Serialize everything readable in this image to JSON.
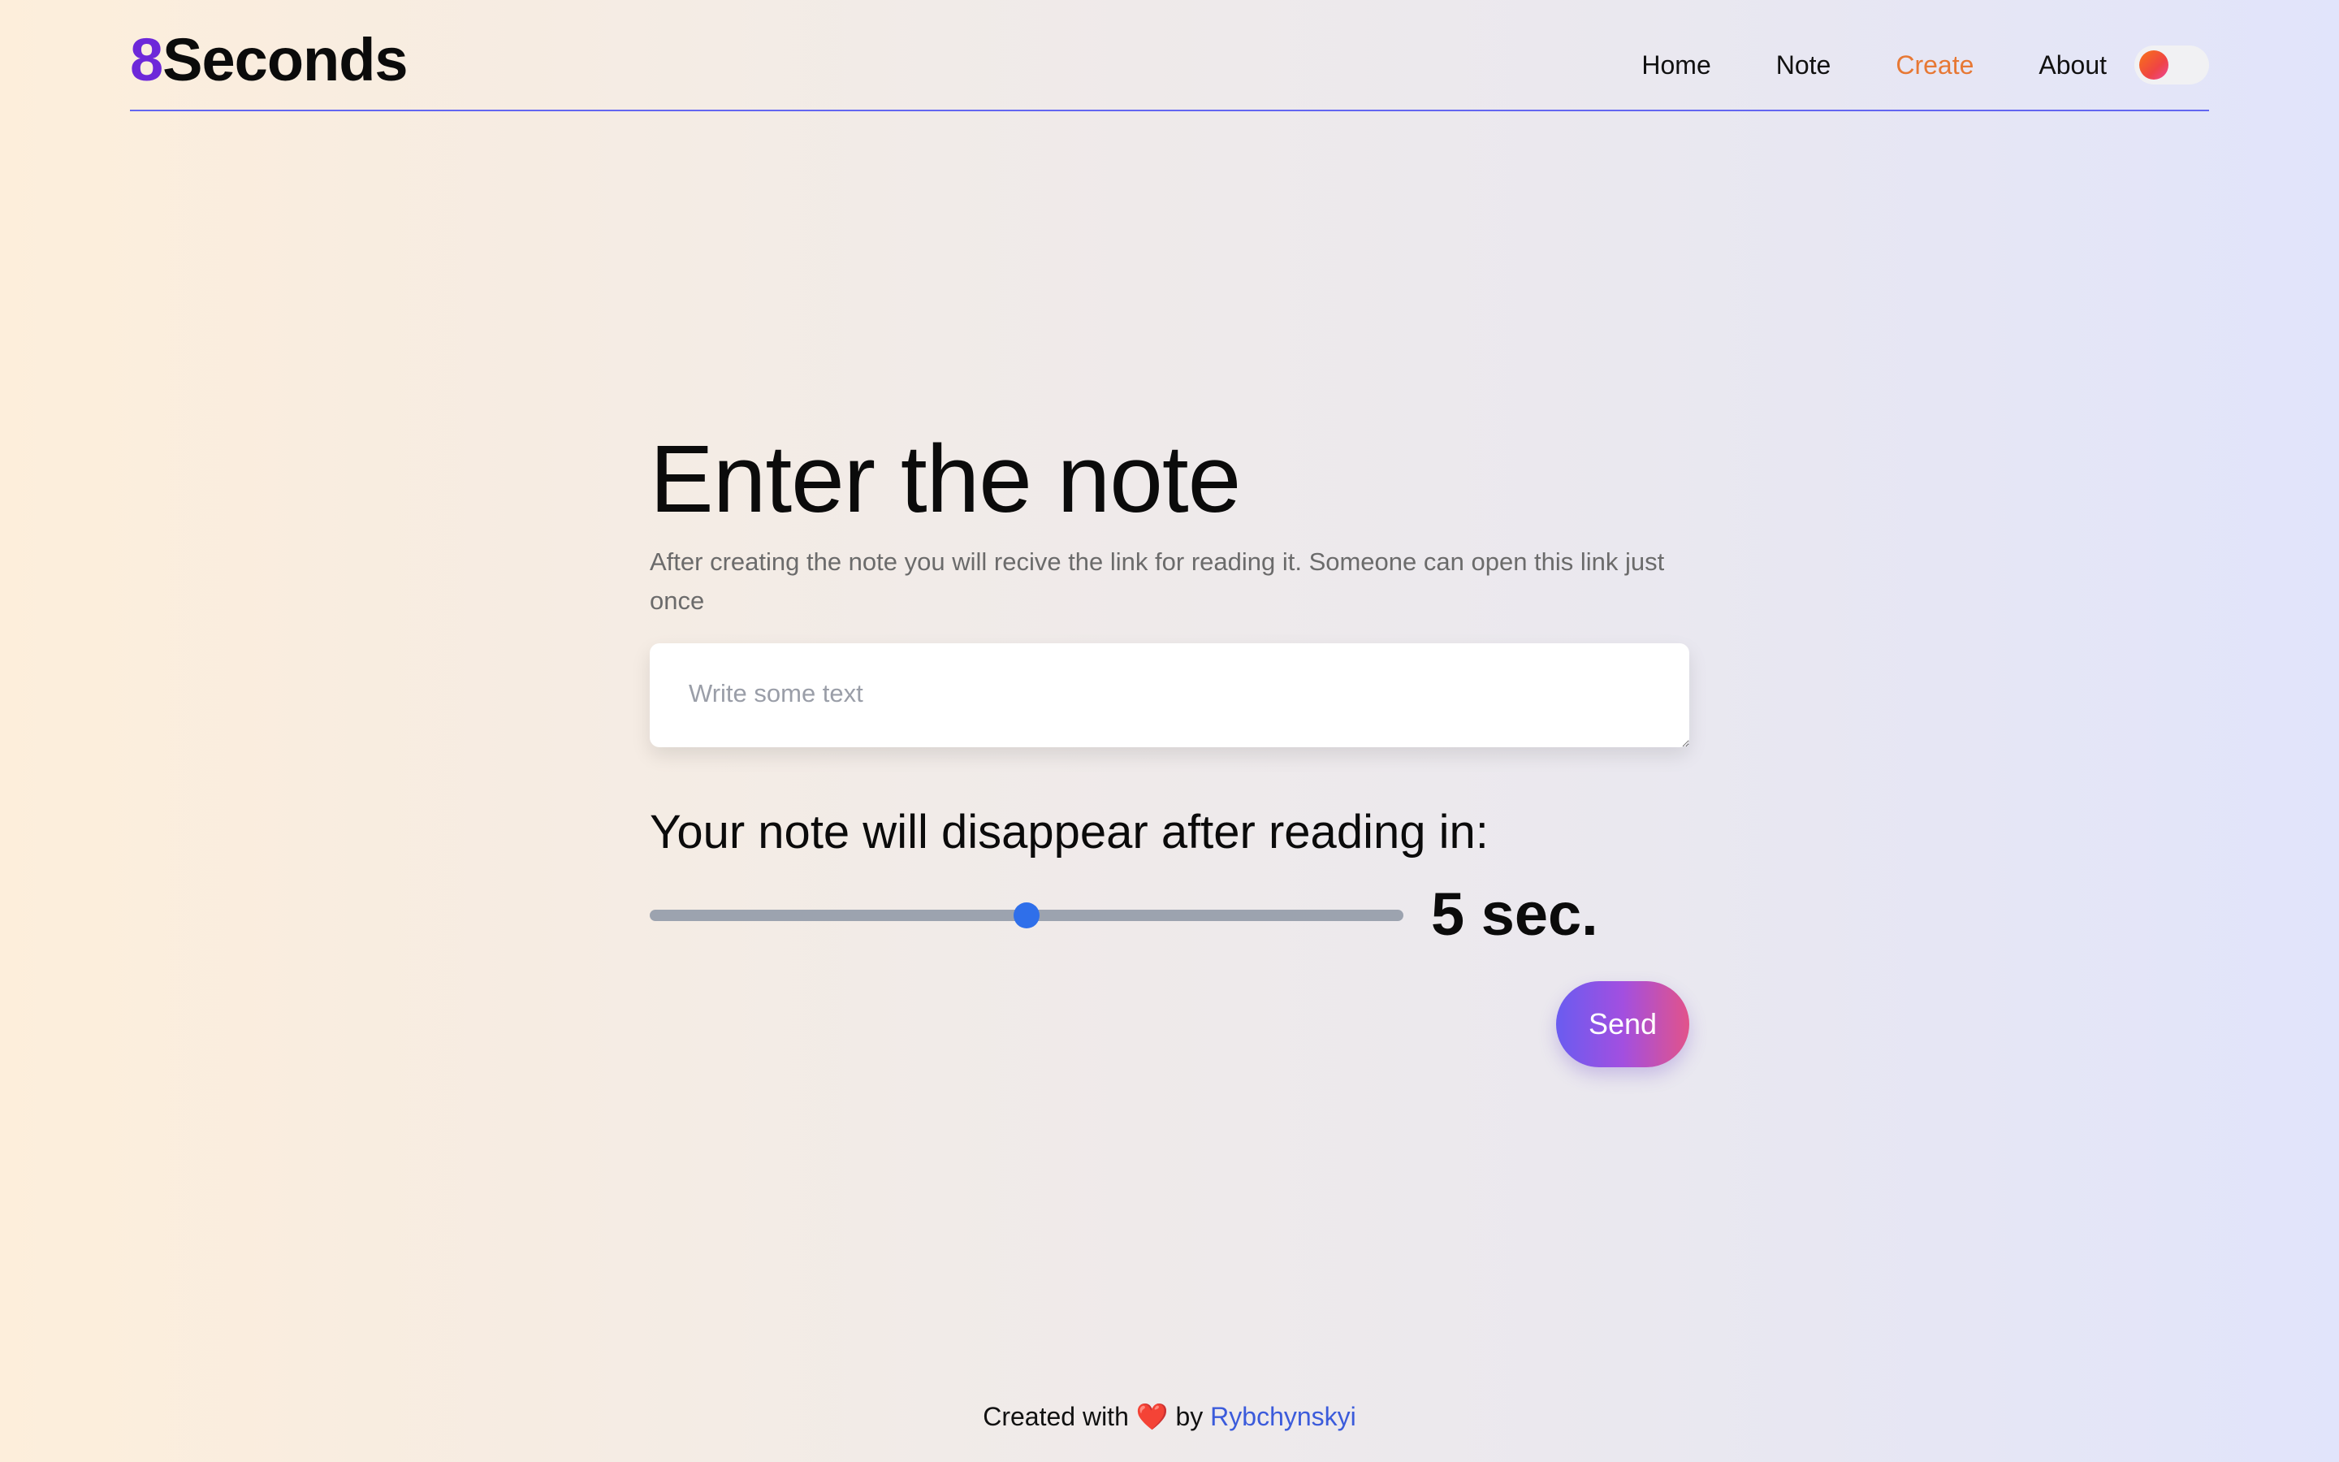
{
  "header": {
    "logo_digit": "8",
    "logo_text": "Seconds",
    "nav": [
      {
        "label": "Home"
      },
      {
        "label": "Note"
      },
      {
        "label": "Create",
        "active": true
      },
      {
        "label": "About"
      }
    ],
    "theme_toggle": {
      "state": "off"
    }
  },
  "main": {
    "title": "Enter the note",
    "subtitle": "After creating the note you will recive the link for reading it. Someone can open this link just once",
    "note_input": {
      "placeholder": "Write some text",
      "value": ""
    },
    "disappear_label": "Your note will disappear after reading in:",
    "slider": {
      "fraction": 0.5
    },
    "seconds_value": "5 sec.",
    "send_label": "Send"
  },
  "footer": {
    "created_with": "Created with",
    "heart": "❤️",
    "by": "by",
    "author": "Rybchynskyi"
  },
  "colors": {
    "accent": "#6d28d9",
    "active_nav": "#e77834",
    "slider_thumb": "#2f6fea",
    "link": "#3b5bdb"
  }
}
